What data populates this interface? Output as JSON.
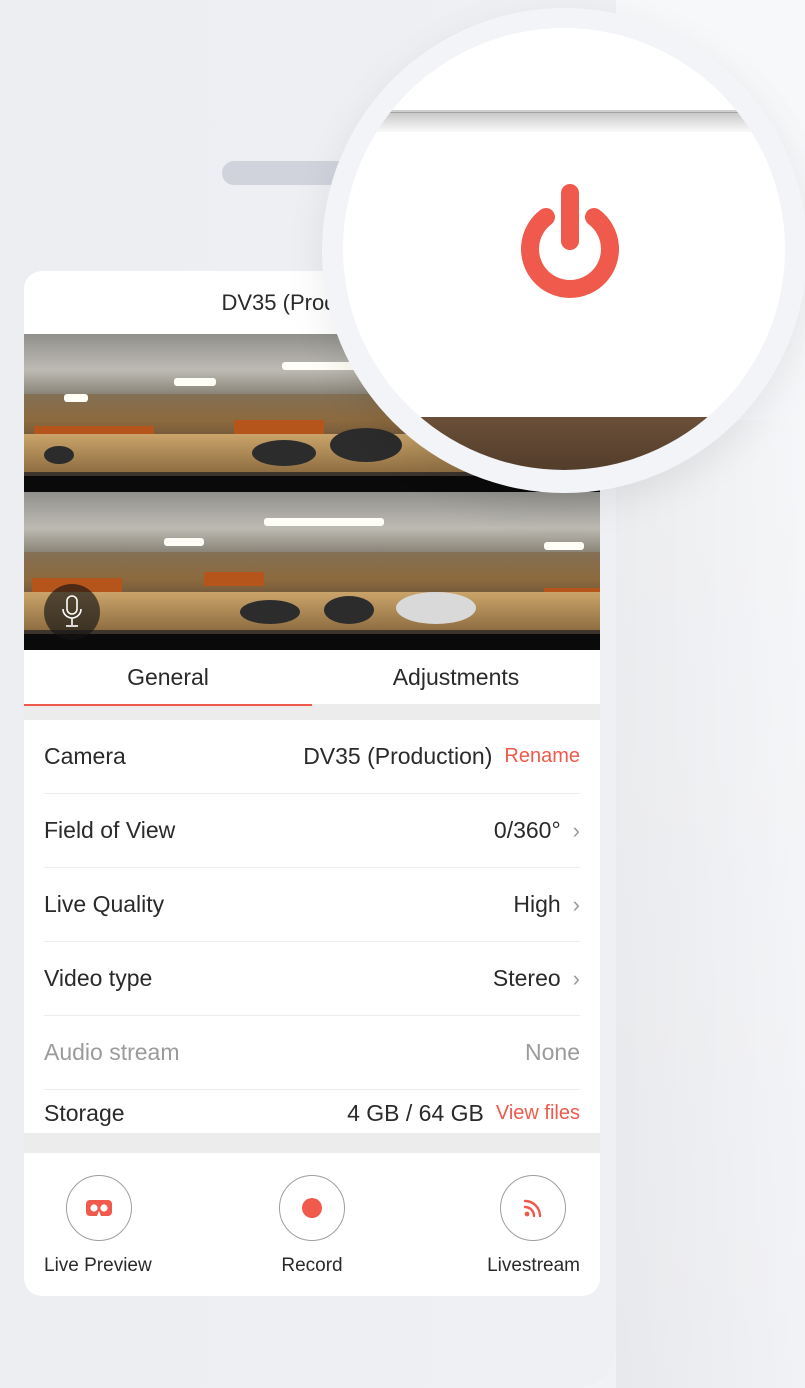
{
  "header": {
    "title": "DV35 (Production)"
  },
  "preview": {
    "mic_icon": "microphone-icon"
  },
  "tabs": [
    {
      "label": "General",
      "active": true
    },
    {
      "label": "Adjustments",
      "active": false
    }
  ],
  "settings": {
    "camera": {
      "label": "Camera",
      "value": "DV35 (Production)",
      "action": "Rename"
    },
    "fov": {
      "label": "Field of View",
      "value": "0/360°"
    },
    "live_quality": {
      "label": "Live Quality",
      "value": "High"
    },
    "video_type": {
      "label": "Video type",
      "value": "Stereo"
    },
    "audio_stream": {
      "label": "Audio stream",
      "value": "None"
    },
    "storage": {
      "label": "Storage",
      "value": "4 GB / 64 GB",
      "action": "View files"
    }
  },
  "actions": {
    "live_preview": {
      "label": "Live Preview",
      "icon": "vr-headset-icon"
    },
    "record": {
      "label": "Record",
      "icon": "record-dot-icon"
    },
    "livestream": {
      "label": "Livestream",
      "icon": "broadcast-icon"
    }
  },
  "magnifier": {
    "icon": "power-icon"
  },
  "colors": {
    "accent": "#ef5a4c",
    "text": "#2a2a2a",
    "muted": "#9b9b9b"
  }
}
